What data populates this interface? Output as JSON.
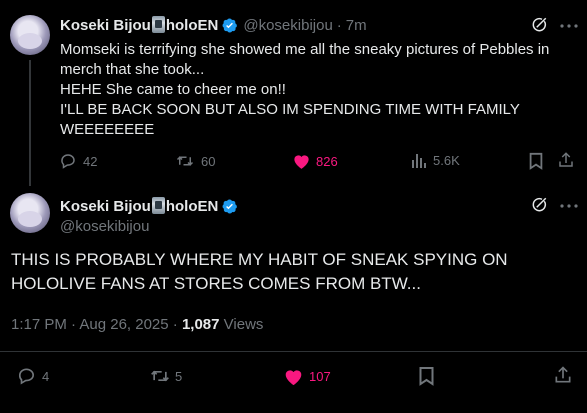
{
  "parent_tweet": {
    "author_name": "Koseki Bijou",
    "author_name_suffix": "holoEN",
    "handle": "@kosekibijou",
    "separator": "·",
    "time": "7m",
    "text": "Momseki is terrifying she showed me all the sneaky pictures of Pebbles in merch that she took...\nHEHE She came to cheer me on!!\nI'LL BE BACK SOON BUT ALSO IM SPENDING TIME WITH FAMILY WEEEEEEEE",
    "replies": "42",
    "reposts": "60",
    "likes": "826",
    "views": "5.6K"
  },
  "main_tweet": {
    "author_name": "Koseki Bijou",
    "author_name_suffix": "holoEN",
    "handle": "@kosekibijou",
    "text": "THIS IS PROBABLY WHERE MY HABIT OF SNEAK SPYING ON HOLOLIVE FANS AT STORES COMES FROM BTW...",
    "timestamp": "1:17 PM · Aug 26, 2025 · ",
    "views_count": "1,087",
    "views_label": " Views",
    "replies": "4",
    "reposts": "5",
    "likes": "107"
  },
  "colors": {
    "like_active": "#f91880",
    "verified": "#1d9bf0",
    "muted": "#71767b"
  }
}
